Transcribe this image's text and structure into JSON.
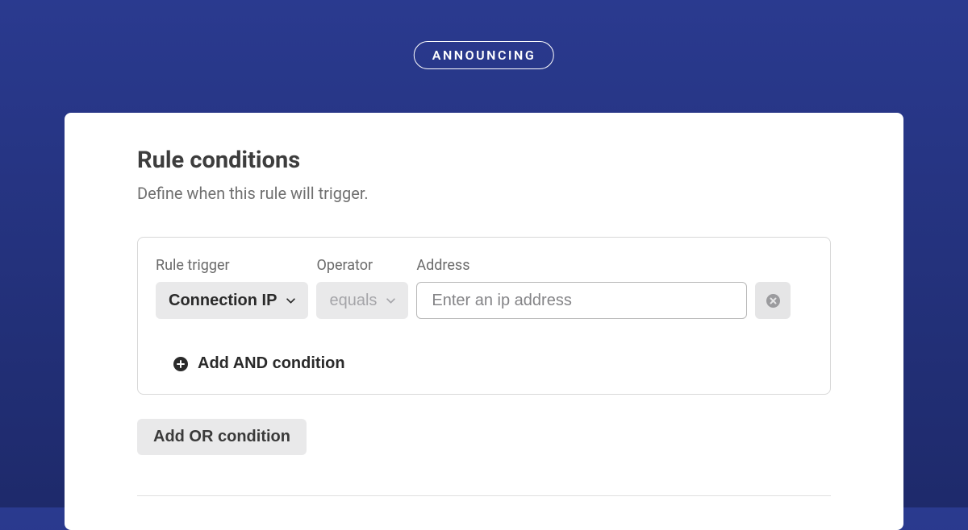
{
  "badge": {
    "text": "ANNOUNCING"
  },
  "header": {
    "title": "Rule conditions",
    "subtitle": "Define when this rule will trigger."
  },
  "condition": {
    "trigger": {
      "label": "Rule trigger",
      "value": "Connection IP"
    },
    "operator": {
      "label": "Operator",
      "value": "equals"
    },
    "address": {
      "label": "Address",
      "placeholder": "Enter an ip address",
      "value": ""
    }
  },
  "buttons": {
    "add_and": "Add AND condition",
    "add_or": "Add OR condition"
  }
}
